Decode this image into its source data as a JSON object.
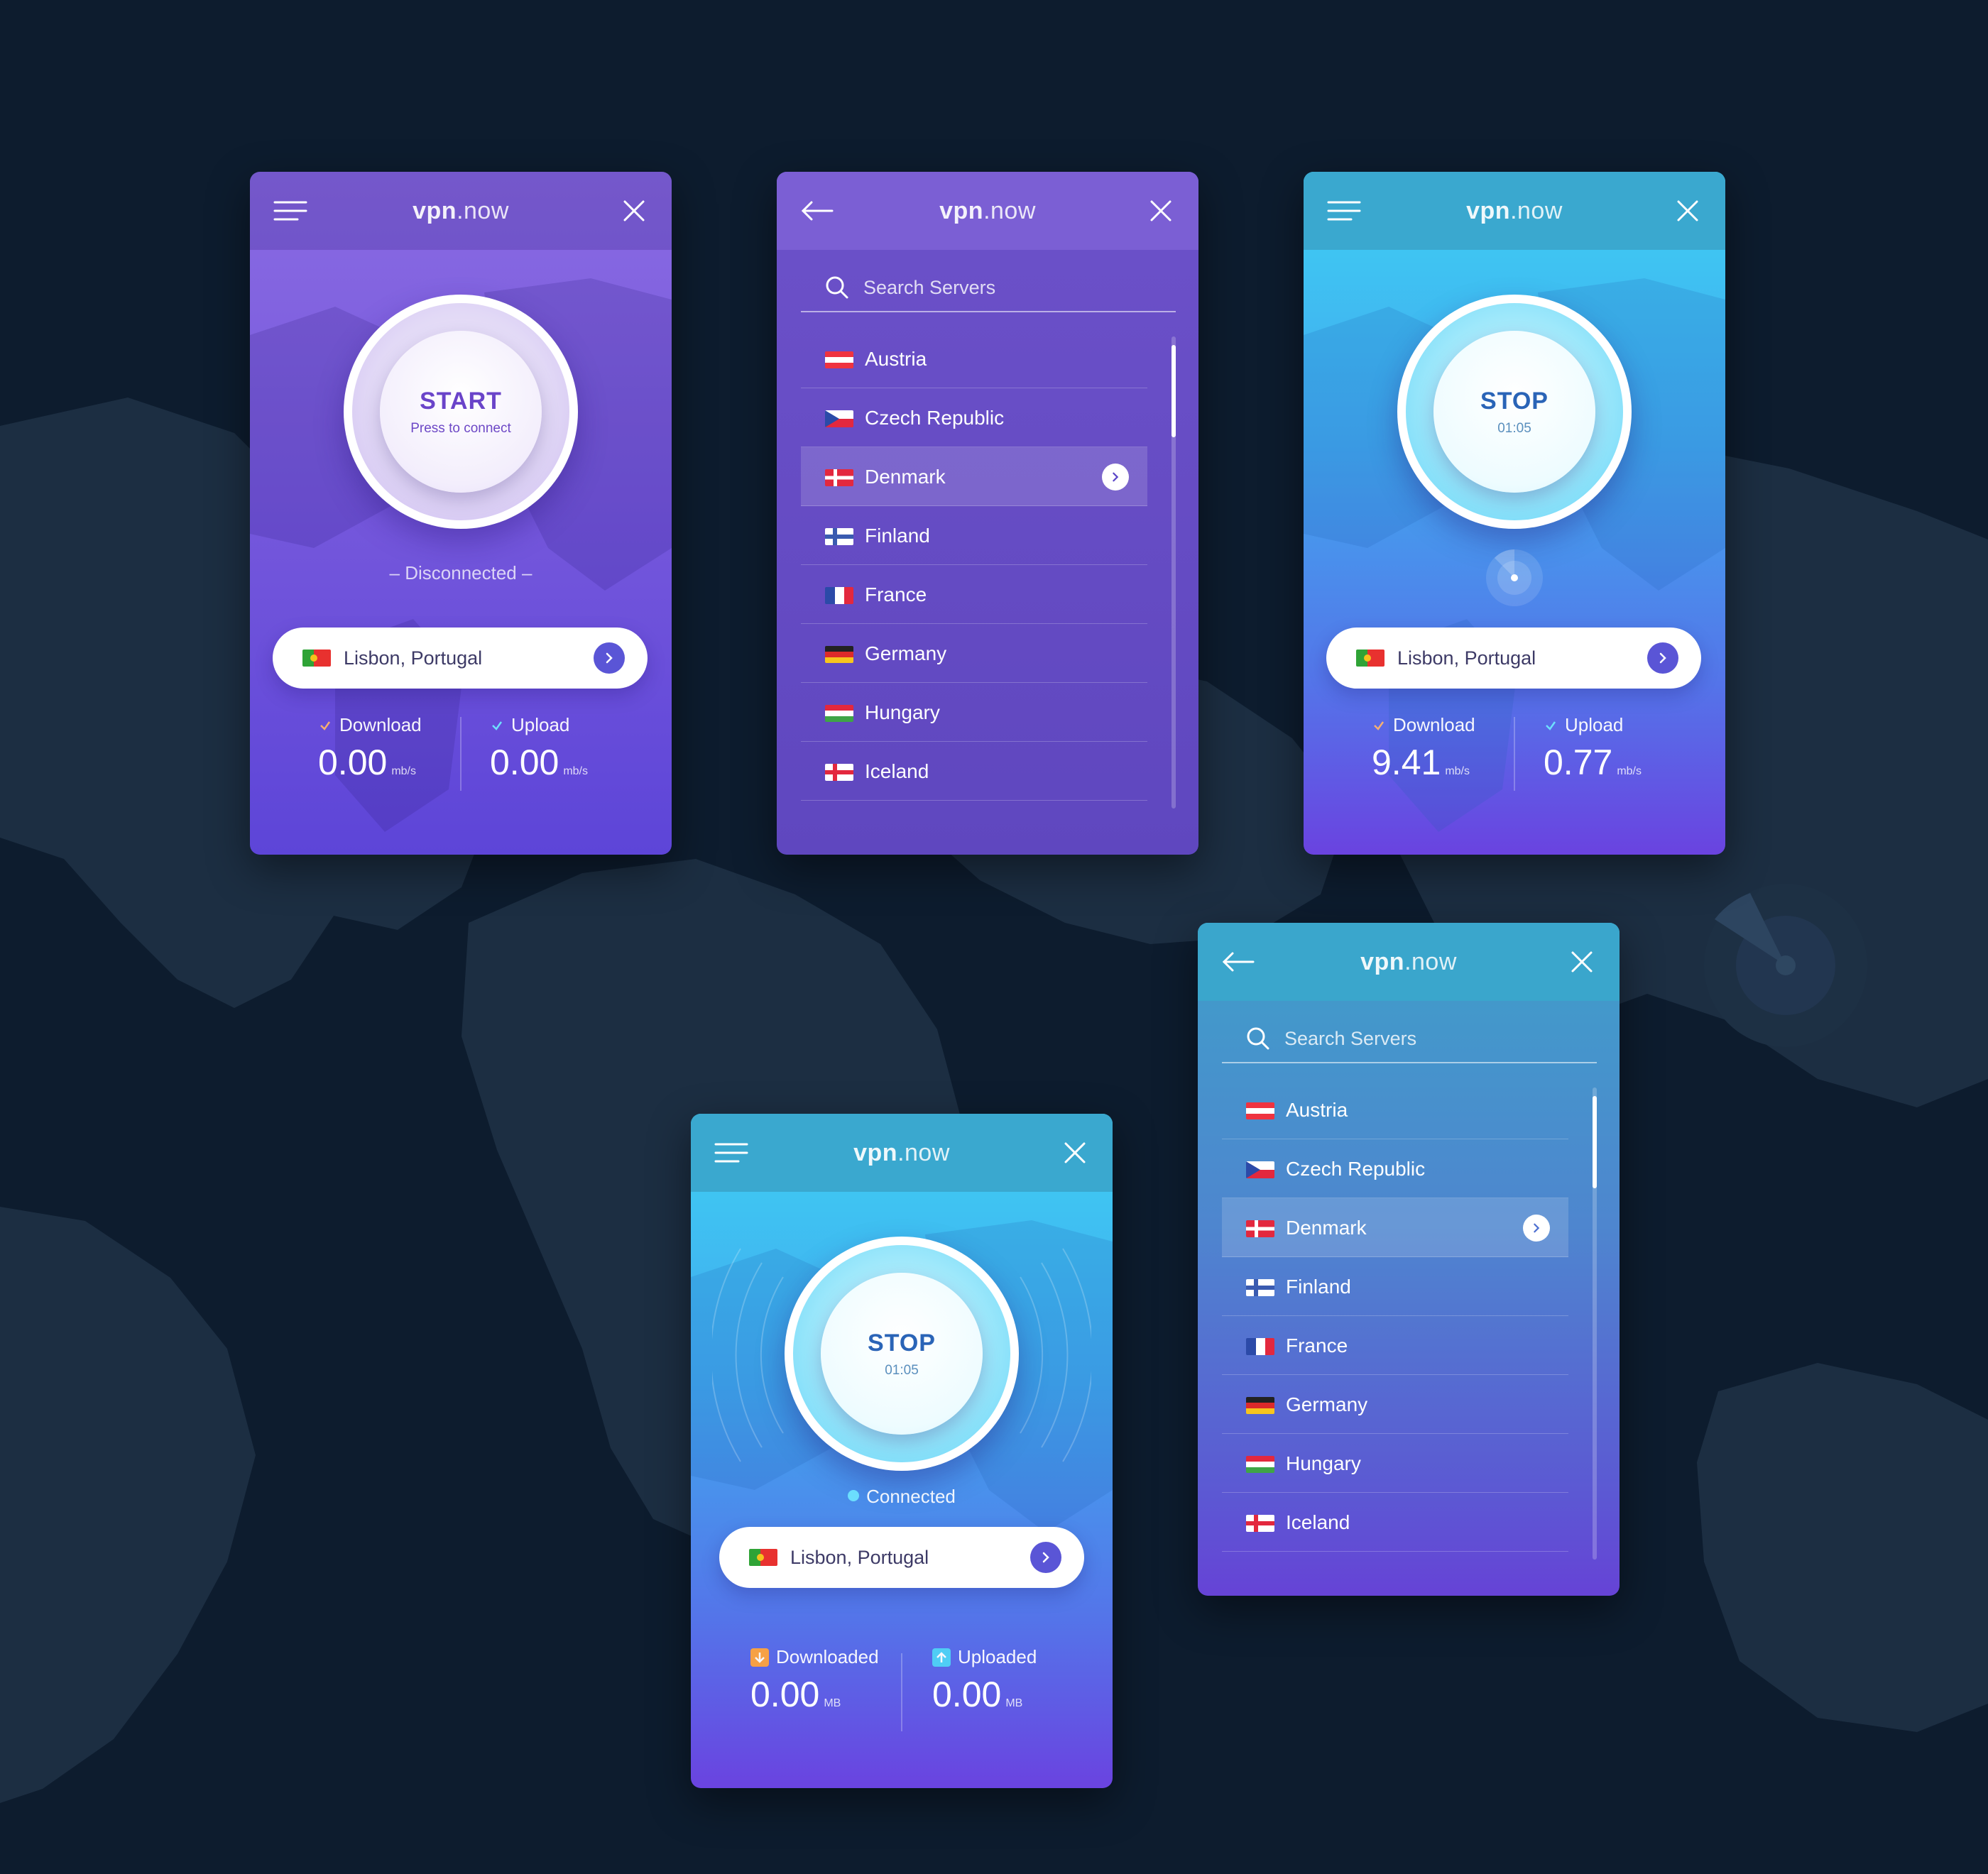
{
  "app": {
    "brand_bold": "vpn",
    "brand_rest": ".now"
  },
  "colors": {
    "bg": "#0d1c2e",
    "accent": "#5a55d6",
    "purple": "#7759dc",
    "blue": "#41a8ee"
  },
  "home_disconnected": {
    "button_title": "START",
    "button_sub": "Press to connect",
    "status": "– Disconnected –",
    "location": "Lisbon, Portugal",
    "download_label": "Download",
    "download_value": "0.00",
    "download_unit": "mb/s",
    "upload_label": "Upload",
    "upload_value": "0.00",
    "upload_unit": "mb/s"
  },
  "home_connecting": {
    "button_title": "STOP",
    "button_sub": "01:05",
    "location": "Lisbon, Portugal",
    "download_label": "Download",
    "download_value": "9.41",
    "download_unit": "mb/s",
    "upload_label": "Upload",
    "upload_value": "0.77",
    "upload_unit": "mb/s"
  },
  "home_connected": {
    "button_title": "STOP",
    "button_sub": "01:05",
    "status": "Connected",
    "location": "Lisbon, Portugal",
    "download_label": "Downloaded",
    "download_value": "0.00",
    "download_unit": "MB",
    "upload_label": "Uploaded",
    "upload_value": "0.00",
    "upload_unit": "MB"
  },
  "server_list": {
    "search_placeholder": "Search Servers",
    "selected": "Denmark",
    "servers": [
      "Austria",
      "Czech Republic",
      "Denmark",
      "Finland",
      "France",
      "Germany",
      "Hungary",
      "Iceland"
    ],
    "icons": {
      "back": "arrow-left-icon",
      "close": "close-icon",
      "menu": "hamburger-icon",
      "search": "search-icon",
      "chevron": "chevron-right-icon"
    }
  }
}
